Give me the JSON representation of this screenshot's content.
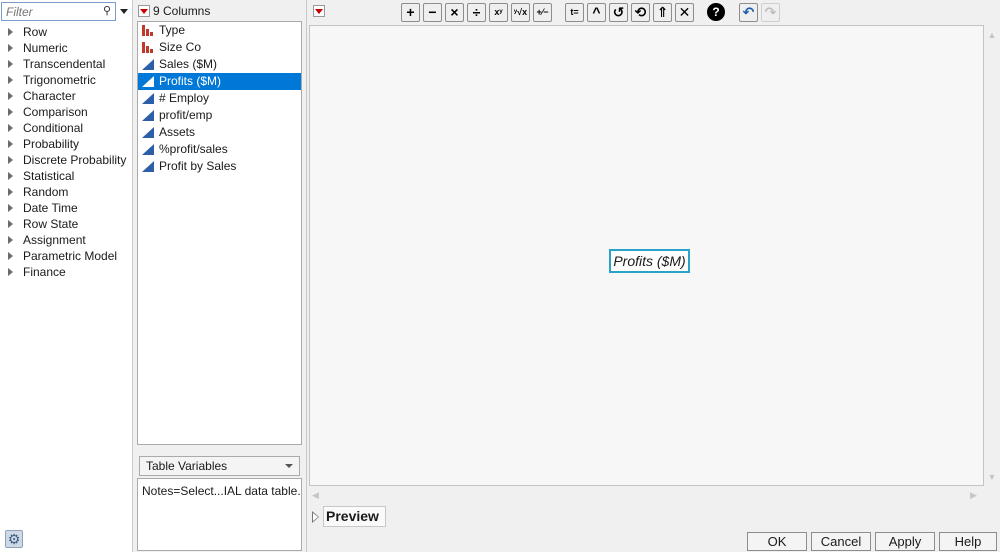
{
  "filter": {
    "placeholder": "Filter",
    "search_icon": "search-icon"
  },
  "categories": [
    "Row",
    "Numeric",
    "Transcendental",
    "Trigonometric",
    "Character",
    "Comparison",
    "Conditional",
    "Probability",
    "Discrete Probability",
    "Statistical",
    "Random",
    "Date Time",
    "Row State",
    "Assignment",
    "Parametric Model",
    "Finance"
  ],
  "columns": {
    "count_label": "9 Columns",
    "items": [
      {
        "label": "Type",
        "icon": "nominal-column-icon"
      },
      {
        "label": "Size Co",
        "icon": "nominal-column-icon"
      },
      {
        "label": "Sales ($M)",
        "icon": "continuous-column-icon"
      },
      {
        "label": "Profits ($M)",
        "icon": "continuous-column-icon",
        "selected": true
      },
      {
        "label": "# Employ",
        "icon": "continuous-column-icon"
      },
      {
        "label": "profit/emp",
        "icon": "continuous-column-icon"
      },
      {
        "label": "Assets",
        "icon": "continuous-column-icon"
      },
      {
        "label": "%profit/sales",
        "icon": "continuous-column-icon"
      },
      {
        "label": "Profit by Sales",
        "icon": "continuous-column-icon"
      }
    ]
  },
  "table_variables": {
    "selected": "Table Variables",
    "notes": "Notes=Select...IAL data table."
  },
  "toolbar": {
    "buttons": [
      {
        "name": "add-icon",
        "glyph": "+"
      },
      {
        "name": "subtract-icon",
        "glyph": "−"
      },
      {
        "name": "multiply-icon",
        "glyph": "×"
      },
      {
        "name": "divide-icon",
        "glyph": "÷"
      },
      {
        "name": "power-icon",
        "glyph": "xʸ"
      },
      {
        "name": "root-icon",
        "glyph": "ʸ√x"
      },
      {
        "name": "plus-minus-icon",
        "glyph": "+⁄−"
      },
      {
        "name": "assign-icon",
        "glyph": "t="
      },
      {
        "name": "peel-icon",
        "glyph": "^"
      },
      {
        "name": "local-variable-icon",
        "glyph": "↺"
      },
      {
        "name": "switch-icon",
        "glyph": "⟲"
      },
      {
        "name": "unary-icon",
        "glyph": "⇑"
      },
      {
        "name": "delete-icon",
        "glyph": "✕"
      },
      {
        "name": "help-icon",
        "glyph": "?"
      },
      {
        "name": "undo-icon",
        "glyph": "↶"
      },
      {
        "name": "redo-icon",
        "glyph": "↷"
      }
    ]
  },
  "formula": {
    "text": "Profits ($M)"
  },
  "preview": {
    "label": "Preview"
  },
  "dialog": {
    "ok": "OK",
    "cancel": "Cancel",
    "apply": "Apply",
    "help": "Help"
  },
  "colors": {
    "selection": "#0078d7",
    "formula_border": "#2aa3c9",
    "nominal_icon": "#c0392b",
    "continuous_icon": "#2d5fa8"
  }
}
